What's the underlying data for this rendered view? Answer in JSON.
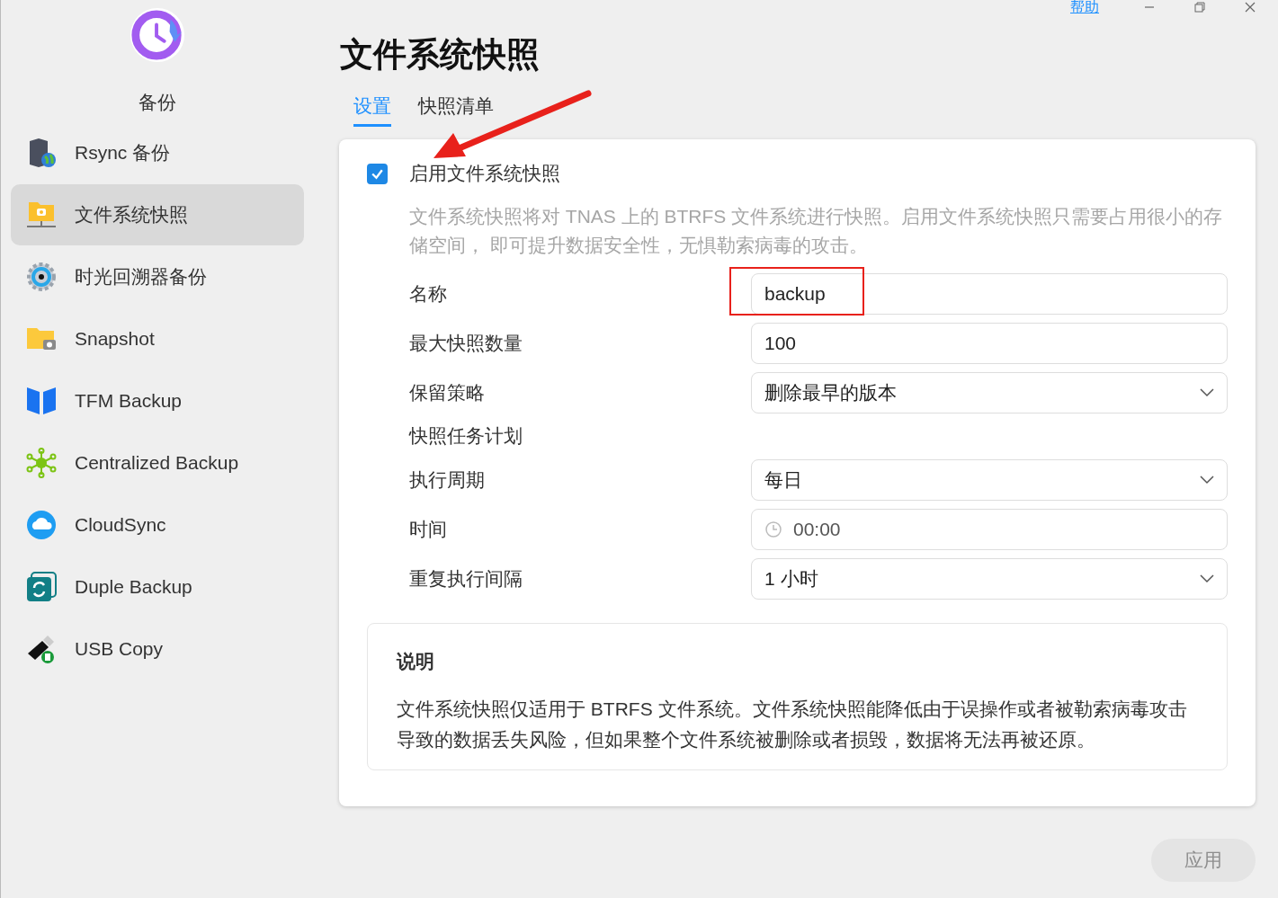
{
  "app": {
    "name": "备份"
  },
  "sidebar": {
    "items": [
      {
        "label": "Rsync 备份",
        "selected": false
      },
      {
        "label": "文件系统快照",
        "selected": true
      },
      {
        "label": "时光回溯器备份",
        "selected": false
      },
      {
        "label": "Snapshot",
        "selected": false
      },
      {
        "label": "TFM Backup",
        "selected": false
      },
      {
        "label": "Centralized Backup",
        "selected": false
      },
      {
        "label": "CloudSync",
        "selected": false
      },
      {
        "label": "Duple Backup",
        "selected": false
      },
      {
        "label": "USB Copy",
        "selected": false
      }
    ]
  },
  "help_link": "帮助",
  "title": "文件系统快照",
  "tabs": [
    {
      "label": "设置",
      "selected": true
    },
    {
      "label": "快照清单",
      "selected": false
    }
  ],
  "enable": {
    "label": "启用文件系统快照",
    "checked": true
  },
  "description": "文件系统快照将对 TNAS 上的 BTRFS 文件系统进行快照。启用文件系统快照只需要占用很小的存储空间， 即可提升数据安全性，无惧勒索病毒的攻击。",
  "fields": [
    {
      "kind": "input",
      "label": "名称",
      "value": "backup",
      "highlighted": true
    },
    {
      "kind": "input",
      "label": "最大快照数量",
      "value": "100",
      "highlighted": false
    },
    {
      "kind": "select",
      "label": "保留策略",
      "value": "删除最早的版本",
      "highlighted": false
    },
    {
      "kind": "heading",
      "label": "快照任务计划",
      "highlighted": false
    },
    {
      "kind": "select",
      "label": "执行周期",
      "value": "每日",
      "highlighted": false
    },
    {
      "kind": "time",
      "label": "时间",
      "value": "00:00",
      "highlighted": false
    },
    {
      "kind": "select",
      "label": "重复执行间隔",
      "value": "1 小时",
      "highlighted": false
    }
  ],
  "note": {
    "title": "说明",
    "text": "文件系统快照仅适用于 BTRFS 文件系统。文件系统快照能降低由于误操作或者被勒索病毒攻击导致的数据丢失风险，但如果整个文件系统被删除或者损毁，数据将无法再被还原。"
  },
  "apply_button": {
    "label": "应用",
    "disabled": true
  }
}
